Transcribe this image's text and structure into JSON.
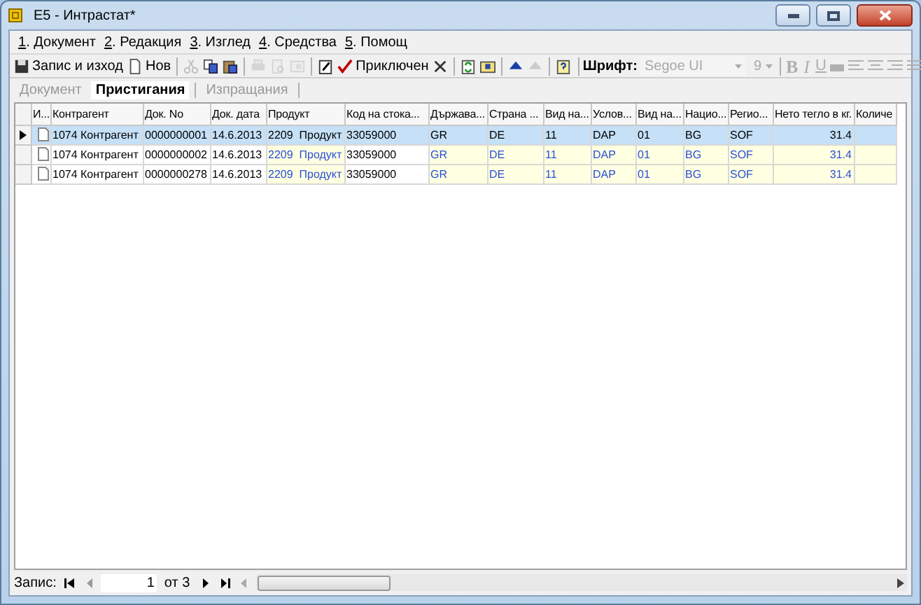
{
  "window": {
    "title": "E5 - Интрастат*"
  },
  "menu": [
    {
      "key": "1",
      "label": ". Документ"
    },
    {
      "key": "2",
      "label": ". Редакция"
    },
    {
      "key": "3",
      "label": ". Изглед"
    },
    {
      "key": "4",
      "label": ". Средства"
    },
    {
      "key": "5",
      "label": ". Помощ"
    }
  ],
  "toolbar": [
    {
      "kind": "save",
      "label": "Запис и изход",
      "disabled": false
    },
    {
      "kind": "new",
      "label": "Нов",
      "disabled": false
    },
    {
      "kind": "sep"
    },
    {
      "kind": "cut",
      "disabled": true
    },
    {
      "kind": "copy",
      "disabled": false
    },
    {
      "kind": "paste",
      "disabled": false
    },
    {
      "kind": "sep"
    },
    {
      "kind": "print",
      "disabled": true
    },
    {
      "kind": "preview",
      "disabled": true
    },
    {
      "kind": "export",
      "disabled": true
    },
    {
      "kind": "sep"
    },
    {
      "kind": "note",
      "disabled": false
    },
    {
      "kind": "check",
      "label": "Приключен",
      "disabled": false
    },
    {
      "kind": "delete",
      "disabled": false
    },
    {
      "kind": "sep"
    },
    {
      "kind": "refresh",
      "disabled": false
    },
    {
      "kind": "card",
      "disabled": false
    },
    {
      "kind": "sep"
    },
    {
      "kind": "up",
      "disabled": false
    },
    {
      "kind": "down",
      "disabled": true
    },
    {
      "kind": "sep"
    },
    {
      "kind": "help",
      "disabled": false
    }
  ],
  "format_bar": {
    "font_label": "Шрифт:",
    "font": "Segoe UI",
    "size": "9",
    "bold": "B",
    "italic": "I",
    "underline": "U"
  },
  "tabs": [
    {
      "label": "Документ",
      "selected": false
    },
    {
      "label": "Пристигания",
      "selected": true
    },
    {
      "label": "Изпращания",
      "selected": false
    }
  ],
  "table": {
    "columns": [
      {
        "label": "И...",
        "editable": false
      },
      {
        "label": "Контрагент",
        "editable": false
      },
      {
        "label": "Док. No",
        "editable": false
      },
      {
        "label": "Док. дата",
        "editable": false
      },
      {
        "label": "Продукт",
        "editable": true
      },
      {
        "label": "Код на стока...",
        "editable": false
      },
      {
        "label": "Държава...",
        "editable": true
      },
      {
        "label": "Страна ...",
        "editable": true
      },
      {
        "label": "Вид на...",
        "editable": true
      },
      {
        "label": "Услов...",
        "editable": true
      },
      {
        "label": "Вид на...",
        "editable": true
      },
      {
        "label": "Нацио...",
        "editable": true
      },
      {
        "label": "Регио...",
        "editable": true
      },
      {
        "label": "Нето тегло в кг.",
        "editable": true
      },
      {
        "label": "Количе",
        "editable": true
      }
    ],
    "rows": [
      {
        "selected": true,
        "cells": [
          "",
          "1074 Контрагент",
          "0000000001",
          "14.6.2013",
          "2209  Продукт",
          "33059000",
          "GR",
          "DE",
          "11",
          "DAP",
          "01",
          "BG",
          "SOF",
          "31.4",
          ""
        ]
      },
      {
        "selected": false,
        "cells": [
          "",
          "1074 Контрагент",
          "0000000002",
          "14.6.2013",
          "2209  Продукт",
          "33059000",
          "GR",
          "DE",
          "11",
          "DAP",
          "01",
          "BG",
          "SOF",
          "31.4",
          ""
        ]
      },
      {
        "selected": false,
        "cells": [
          "",
          "1074 Контрагент",
          "0000000278",
          "14.6.2013",
          "2209  Продукт",
          "33059000",
          "GR",
          "DE",
          "11",
          "DAP",
          "01",
          "BG",
          "SOF",
          "31.4",
          ""
        ]
      }
    ]
  },
  "navigator": {
    "label": "Запис:",
    "record": "1",
    "of": "от 3"
  }
}
